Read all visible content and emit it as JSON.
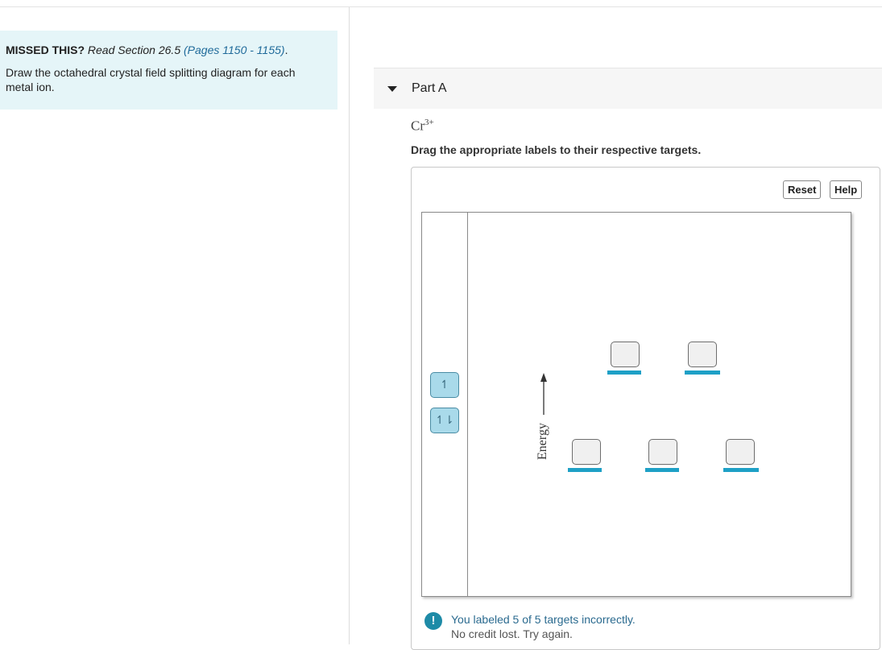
{
  "hint": {
    "missed": "MISSED THIS?",
    "read": "Read Section 26.5",
    "pages": "(Pages 1150 - 1155)",
    "period": ".",
    "prompt": "Draw the octahedral crystal field splitting diagram for each metal ion."
  },
  "part": {
    "title": "Part A",
    "ion_base": "Cr",
    "ion_charge": "3+",
    "instruction": "Drag the appropriate labels to their respective targets."
  },
  "toolbar": {
    "reset_label": "Reset",
    "help_label": "Help"
  },
  "palette": {
    "labels": [
      "↿",
      "↿⇂"
    ]
  },
  "diagram": {
    "axis_label": "Energy",
    "upper_targets": 2,
    "lower_targets": 3
  },
  "feedback": {
    "icon": "!",
    "result": "You labeled 5 of 5 targets incorrectly.",
    "note": "No credit lost. Try again."
  },
  "colors": {
    "accent": "#1ea0c6",
    "hint_bg": "#e5f5f8",
    "chip_bg": "#a9daea",
    "link": "#1f6a9a"
  }
}
